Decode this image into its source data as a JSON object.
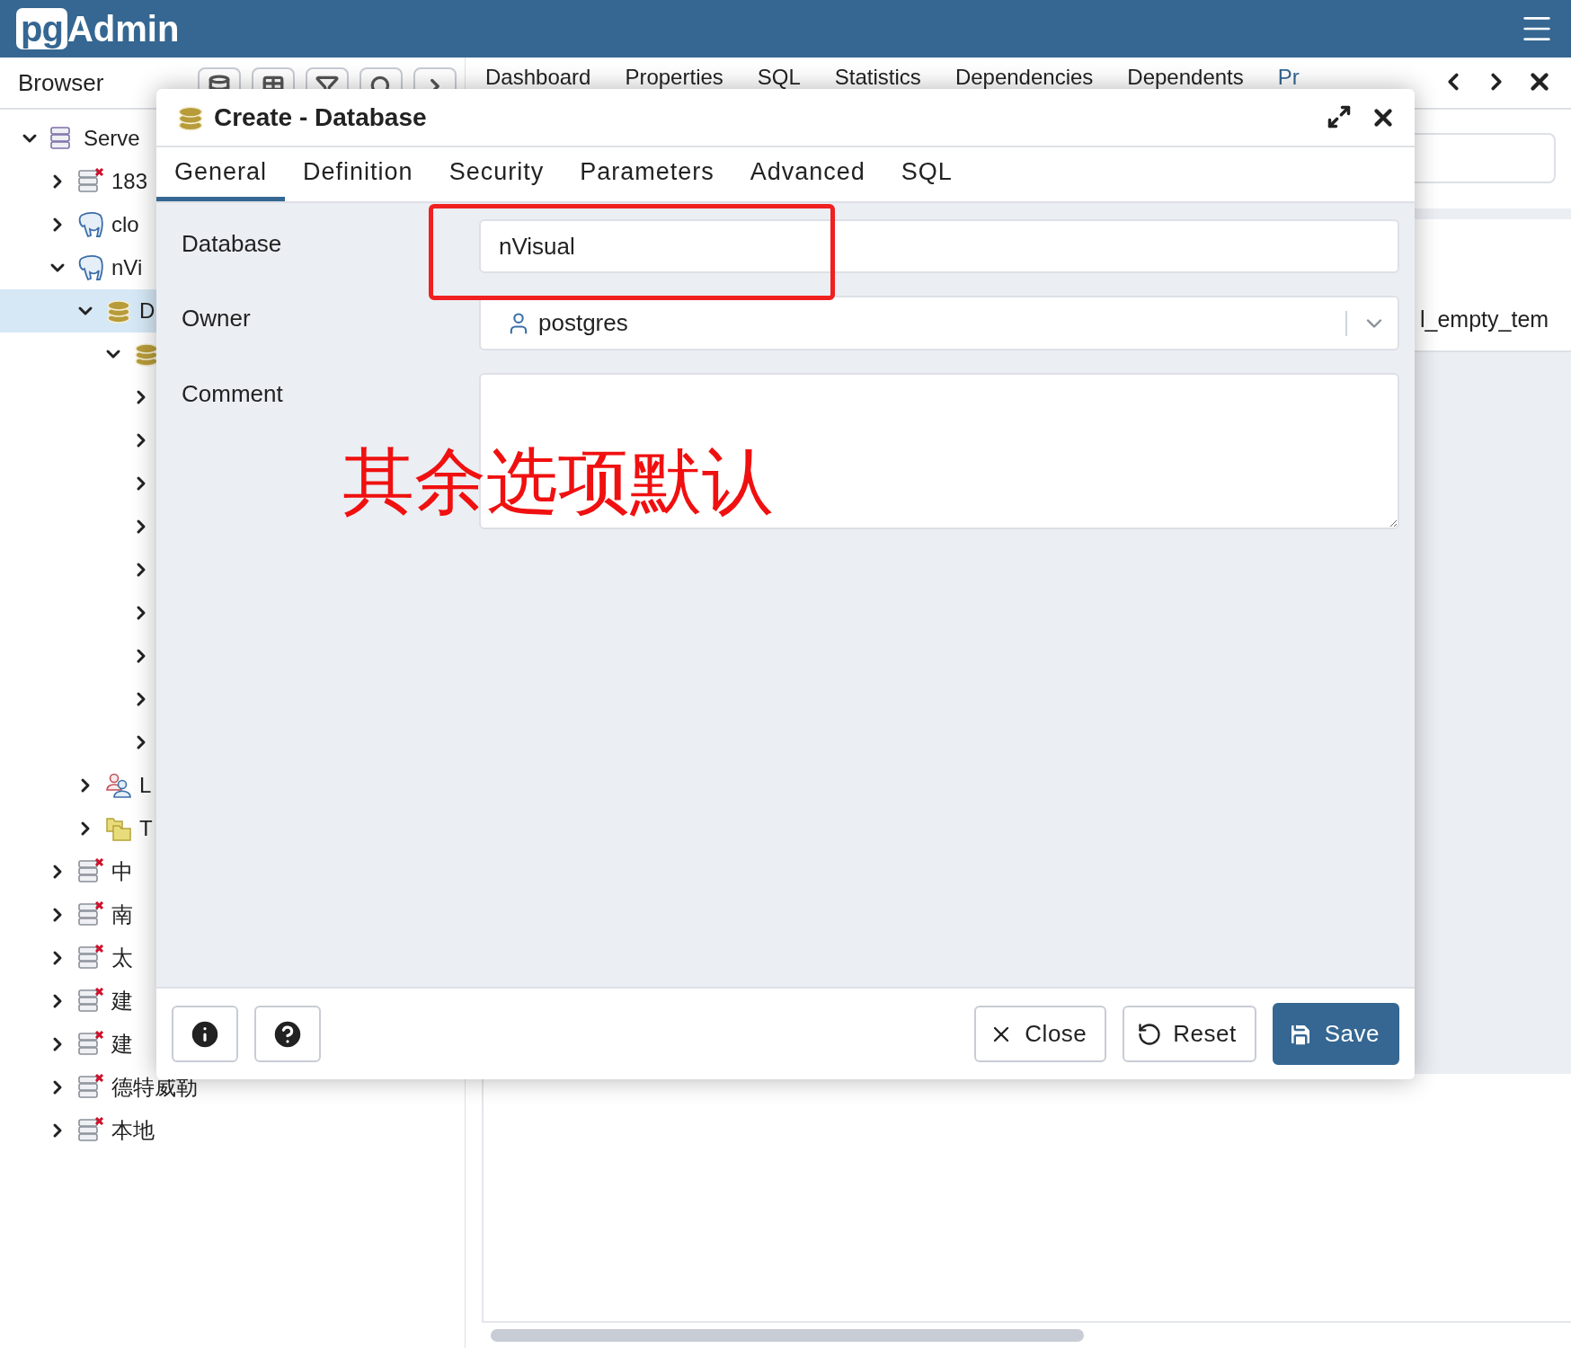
{
  "app": {
    "logo_prefix": "pg",
    "logo_suffix": "Admin"
  },
  "browser": {
    "title": "Browser",
    "tree": [
      {
        "kind": "server-group",
        "label": "Serve",
        "expanded": true,
        "selected": false,
        "children": [
          {
            "kind": "server-off",
            "label": "183",
            "expanded": false,
            "selected": false
          },
          {
            "kind": "postgres",
            "label": "clo",
            "expanded": false,
            "selected": false
          },
          {
            "kind": "postgres",
            "label": "nVi",
            "expanded": true,
            "selected": false,
            "children": [
              {
                "kind": "database",
                "label": "D",
                "expanded": true,
                "selected": true,
                "children": [
                  {
                    "kind": "database",
                    "expanded": true,
                    "selected": false,
                    "children": [
                      {
                        "expanded": false,
                        "selected": false
                      },
                      {
                        "expanded": false,
                        "selected": false
                      },
                      {
                        "expanded": false,
                        "selected": false
                      },
                      {
                        "expanded": false,
                        "selected": false
                      },
                      {
                        "expanded": false,
                        "selected": false
                      },
                      {
                        "expanded": false,
                        "selected": false
                      },
                      {
                        "expanded": false,
                        "selected": false
                      },
                      {
                        "expanded": false,
                        "selected": false
                      },
                      {
                        "expanded": false,
                        "selected": false
                      }
                    ]
                  }
                ]
              },
              {
                "kind": "login-roles",
                "label": "L",
                "expanded": false,
                "selected": false
              },
              {
                "kind": "tablespaces",
                "label": "T",
                "expanded": false,
                "selected": false
              }
            ]
          },
          {
            "kind": "server-off",
            "label": "中",
            "expanded": false,
            "selected": false
          },
          {
            "kind": "server-off",
            "label": "南",
            "expanded": false,
            "selected": false
          },
          {
            "kind": "server-off",
            "label": "太",
            "expanded": false,
            "selected": false
          },
          {
            "kind": "server-off",
            "label": "建",
            "expanded": false,
            "selected": false
          },
          {
            "kind": "server-off",
            "label": "建",
            "expanded": false,
            "selected": false
          },
          {
            "kind": "server-off",
            "label": "德特威勒",
            "expanded": false,
            "selected": false
          },
          {
            "kind": "server-off",
            "label": "本地",
            "expanded": false,
            "selected": false
          }
        ]
      }
    ]
  },
  "panel_tabs": [
    {
      "label": "Dashboard",
      "selected": false
    },
    {
      "label": "Properties",
      "selected": false
    },
    {
      "label": "SQL",
      "selected": false
    },
    {
      "label": "Statistics",
      "selected": false
    },
    {
      "label": "Dependencies",
      "selected": false
    },
    {
      "label": "Dependents",
      "selected": false
    },
    {
      "label": "Pr",
      "selected": true
    }
  ],
  "properties": {
    "row_text": "l_empty_tem"
  },
  "dialog": {
    "title": "Create - Database",
    "tabs": [
      {
        "label": "General",
        "selected": true
      },
      {
        "label": "Definition",
        "selected": false
      },
      {
        "label": "Security",
        "selected": false
      },
      {
        "label": "Parameters",
        "selected": false
      },
      {
        "label": "Advanced",
        "selected": false
      },
      {
        "label": "SQL",
        "selected": false
      }
    ],
    "fields": [
      {
        "label": "Database",
        "kind": "text",
        "value": "nVisual"
      },
      {
        "label": "Owner",
        "kind": "select",
        "value": "postgres"
      },
      {
        "label": "Comment",
        "kind": "textarea"
      }
    ],
    "buttons": [
      {
        "label": "Close",
        "kind": "close"
      },
      {
        "label": "Reset",
        "kind": "reset"
      },
      {
        "label": "Save",
        "kind": "save"
      }
    ]
  },
  "annotation": {
    "note": "其余选项默认"
  }
}
